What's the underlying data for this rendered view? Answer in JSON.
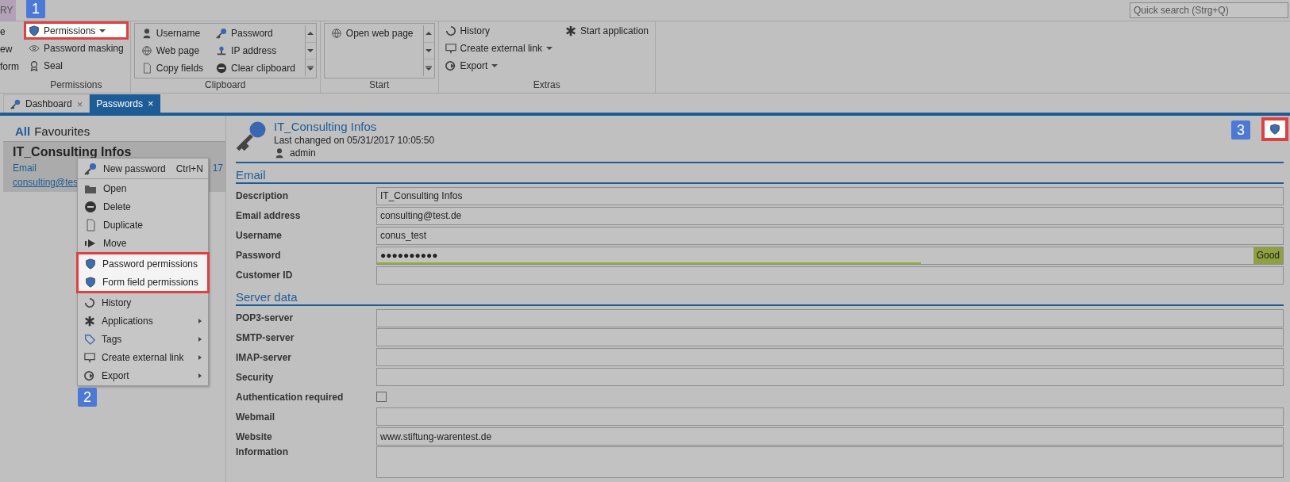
{
  "top_bar": {
    "app_tab": "RY",
    "quick_search": {
      "placeholder": "Quick search (Strg+Q)"
    }
  },
  "ribbon": {
    "cut_items": [
      "e",
      "ew",
      "form"
    ],
    "groups": [
      {
        "label": "Permissions",
        "columns": [
          [
            {
              "label": "Permissions",
              "dropdown": true,
              "highlighted": true,
              "callout": "1"
            },
            {
              "label": "Password masking",
              "dropdown": false,
              "highlighted": false
            },
            {
              "label": "Seal",
              "dropdown": false,
              "highlighted": false
            }
          ]
        ],
        "gallery": false
      },
      {
        "label": "Clipboard",
        "columns": [
          [
            {
              "label": "Username",
              "dropdown": false,
              "highlighted": false
            },
            {
              "label": "Web page",
              "dropdown": false,
              "highlighted": false
            },
            {
              "label": "Copy fields",
              "dropdown": false,
              "highlighted": false
            }
          ],
          [
            {
              "label": "Password",
              "dropdown": false,
              "highlighted": false
            },
            {
              "label": "IP address",
              "dropdown": false,
              "highlighted": false
            },
            {
              "label": "Clear clipboard",
              "dropdown": false,
              "highlighted": false
            }
          ]
        ],
        "gallery": true
      },
      {
        "label": "Start",
        "columns": [
          [
            {
              "label": "Open web page",
              "dropdown": false,
              "highlighted": false
            }
          ]
        ],
        "gallery": true
      },
      {
        "label": "Extras",
        "columns": [
          [
            {
              "label": "History",
              "dropdown": false,
              "highlighted": false
            },
            {
              "label": "Create external link",
              "dropdown": true,
              "highlighted": false
            },
            {
              "label": "Export",
              "dropdown": true,
              "highlighted": false
            }
          ],
          [
            {
              "label": "Start application",
              "dropdown": false,
              "highlighted": false
            }
          ]
        ],
        "gallery": false
      }
    ]
  },
  "tabs": [
    {
      "label": "Dashboard",
      "selected": false,
      "close": "×"
    },
    {
      "label": "Passwords",
      "selected": true,
      "close": "×"
    }
  ],
  "sidebar": {
    "filters": [
      {
        "label": "All",
        "selected": true
      },
      {
        "label": "Favourites",
        "selected": false
      }
    ],
    "items": [
      {
        "title": "IT_Consulting Infos",
        "type": "Email",
        "date": "17",
        "email": "consulting@tes",
        "selected": true
      }
    ]
  },
  "context_menu": {
    "callout": "2",
    "items": [
      {
        "label": "New password",
        "shortcut": "Ctrl+N",
        "submenu": false,
        "highlighted": false,
        "separator_after": true
      },
      {
        "label": "Open",
        "submenu": false,
        "highlighted": false,
        "separator_after": false
      },
      {
        "label": "Delete",
        "submenu": false,
        "highlighted": false,
        "separator_after": false
      },
      {
        "label": "Duplicate",
        "submenu": false,
        "highlighted": false,
        "separator_after": false
      },
      {
        "label": "Move",
        "submenu": false,
        "highlighted": false,
        "separator_after": false
      },
      {
        "label": "Password permissions",
        "submenu": false,
        "highlighted": true,
        "separator_after": false
      },
      {
        "label": "Form field permissions",
        "submenu": false,
        "highlighted": true,
        "separator_after": false
      },
      {
        "label": "History",
        "submenu": false,
        "highlighted": false,
        "separator_after": false
      },
      {
        "label": "Applications",
        "submenu": true,
        "highlighted": false,
        "separator_after": false
      },
      {
        "label": "Tags",
        "submenu": true,
        "highlighted": false,
        "separator_after": false
      },
      {
        "label": "Create external link",
        "submenu": true,
        "highlighted": false,
        "separator_after": false
      },
      {
        "label": "Export",
        "submenu": true,
        "highlighted": false,
        "separator_after": false
      }
    ]
  },
  "detail": {
    "title": "IT_Consulting Infos",
    "changed": "Last changed on 05/31/2017 10:05:50",
    "owner": "admin",
    "permissions_button": {
      "highlighted": true,
      "callout": "3"
    },
    "sections": [
      {
        "title": "Email",
        "fields": [
          {
            "kind": "text",
            "label": "Description",
            "value": "IT_Consulting Infos"
          },
          {
            "kind": "text",
            "label": "Email address",
            "value": "consulting@test.de"
          },
          {
            "kind": "text",
            "label": "Username",
            "value": "conus_test"
          },
          {
            "kind": "password",
            "label": "Password",
            "value": "●●●●●●●●●●",
            "level": 0.6,
            "strength": "Good"
          },
          {
            "kind": "text",
            "label": "Customer ID"
          }
        ]
      },
      {
        "title": "Server data",
        "fields": [
          {
            "kind": "text",
            "label": "POP3-server"
          },
          {
            "kind": "text",
            "label": "SMTP-server"
          },
          {
            "kind": "text",
            "label": "IMAP-server"
          },
          {
            "kind": "text",
            "label": "Security"
          },
          {
            "kind": "checkbox",
            "label": "Authentication required",
            "checked": false
          },
          {
            "kind": "text",
            "label": "Webmail"
          },
          {
            "kind": "text",
            "label": "Website",
            "value": "www.stiftung-warentest.de"
          },
          {
            "kind": "textarea",
            "label": "Information"
          }
        ]
      }
    ]
  }
}
